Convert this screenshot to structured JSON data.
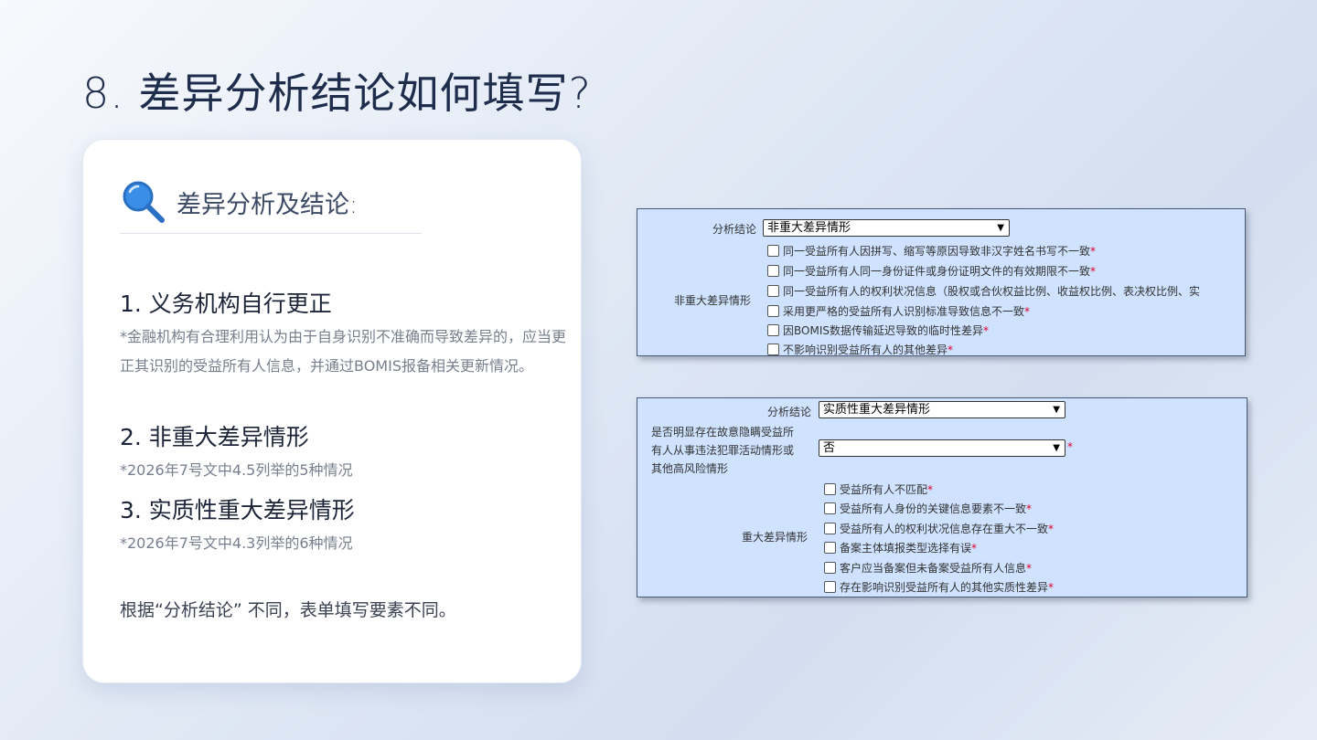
{
  "title": "8. 差异分析结论如何填写?",
  "card": {
    "icon": "magnifier-icon",
    "heading": "差异分析及结论:",
    "items": [
      {
        "title": "1. 义务机构自行更正",
        "note": "*金融机构有合理利用认为由于自身识别不准确而导致差异的，应当更正其识别的受益所有人信息，并通过BOMIS报备相关更新情况。"
      },
      {
        "title": "2. 非重大差异情形",
        "note": "*2026年7号文中4.5列举的5种情况"
      },
      {
        "title": "3. 实质性重大差异情形",
        "note": "*2026年7号文中4.3列举的6种情况"
      }
    ],
    "closing": "根据“分析结论” 不同，表单填写要素不同。"
  },
  "form1": {
    "conclusion_label": "分析结论",
    "conclusion_value": "非重大差异情形",
    "group_label": "非重大差异情形",
    "options": [
      {
        "text": "同一受益所有人因拼写、缩写等原因导致非汉字姓名书写不一致",
        "required": true
      },
      {
        "text": "同一受益所有人同一身份证件或身份证明文件的有效期限不一致",
        "required": true
      },
      {
        "text": "同一受益所有人的权利状况信息（股权或合伙权益比例、收益权比例、表决权比例、实",
        "required": false
      },
      {
        "text": "采用更严格的受益所有人识别标准导致信息不一致",
        "required": true
      },
      {
        "text": "因BOMIS数据传输延迟导致的临时性差异",
        "required": true
      },
      {
        "text": "不影响识别受益所有人的其他差异",
        "required": true
      }
    ]
  },
  "form2": {
    "conclusion_label": "分析结论",
    "conclusion_value": "实质性重大差异情形",
    "risk_label_lines": [
      "是否明显存在故意隐瞒受益所",
      "有人从事违法犯罪活动情形或",
      "其他高风险情形"
    ],
    "risk_value": "否",
    "group_label": "重大差异情形",
    "options": [
      {
        "text": "受益所有人不匹配",
        "required": true
      },
      {
        "text": "受益所有人身份的关键信息要素不一致",
        "required": true
      },
      {
        "text": "受益所有人的权利状况信息存在重大不一致",
        "required": true
      },
      {
        "text": "备案主体填报类型选择有误",
        "required": true
      },
      {
        "text": "客户应当备案但未备案受益所有人信息",
        "required": true
      },
      {
        "text": "存在影响识别受益所有人的其他实质性差异",
        "required": true
      }
    ]
  },
  "colors": {
    "accent": "#3a8ee6",
    "form_bg": "#cfe2ff",
    "required": "#e0002a"
  }
}
